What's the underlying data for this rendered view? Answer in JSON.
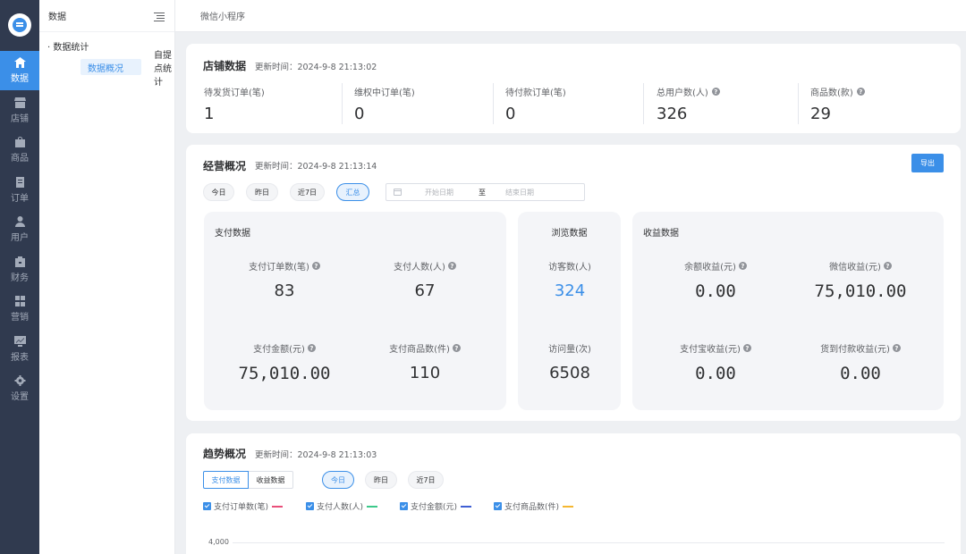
{
  "rail": {
    "items": [
      {
        "label": "数据",
        "icon": "home-icon"
      },
      {
        "label": "店铺",
        "icon": "store-icon"
      },
      {
        "label": "商品",
        "icon": "bag-icon"
      },
      {
        "label": "订单",
        "icon": "order-icon"
      },
      {
        "label": "用户",
        "icon": "user-icon"
      },
      {
        "label": "财务",
        "icon": "wallet-icon"
      },
      {
        "label": "营销",
        "icon": "grid-icon"
      },
      {
        "label": "报表",
        "icon": "chart-icon"
      },
      {
        "label": "设置",
        "icon": "gear-icon"
      }
    ],
    "active_color": "#3b8fe8"
  },
  "subnav": {
    "title": "数据",
    "group": "· 数据统计",
    "links": [
      "数据概况",
      "自提点统计"
    ]
  },
  "topbar": {
    "title": "微信小程序"
  },
  "store": {
    "title": "店铺数据",
    "time": "更新时间：2024-9-8 21:13:02",
    "stats": [
      {
        "label": "待发货订单(笔)",
        "value": "1",
        "help": false
      },
      {
        "label": "维权中订单(笔)",
        "value": "0",
        "help": false
      },
      {
        "label": "待付款订单(笔)",
        "value": "0",
        "help": false
      },
      {
        "label": "总用户数(人)",
        "value": "326",
        "help": true
      },
      {
        "label": "商品数(款)",
        "value": "29",
        "help": true
      }
    ]
  },
  "overview": {
    "title": "经营概况",
    "time": "更新时间：2024-9-8 21:13:14",
    "export": "导出",
    "filters": [
      "今日",
      "昨日",
      "近7日",
      "汇总"
    ],
    "active_filter": "汇总",
    "date_start": "开始日期",
    "date_sep": "至",
    "date_end": "结束日期",
    "pay": {
      "title": "支付数据",
      "metrics": [
        {
          "label": "支付订单数(笔)",
          "value": "83"
        },
        {
          "label": "支付人数(人)",
          "value": "67"
        },
        {
          "label": "支付金额(元)",
          "value": "75,010.00"
        },
        {
          "label": "支付商品数(件)",
          "value": "110"
        }
      ]
    },
    "browse": {
      "title": "浏览数据",
      "metrics": [
        {
          "label": "访客数(人)",
          "value": "324"
        },
        {
          "label": "访问量(次)",
          "value": "6508"
        }
      ]
    },
    "income": {
      "title": "收益数据",
      "metrics": [
        {
          "label": "余额收益(元)",
          "value": "0.00"
        },
        {
          "label": "微信收益(元)",
          "value": "75,010.00"
        },
        {
          "label": "支付宝收益(元)",
          "value": "0.00"
        },
        {
          "label": "货到付款收益(元)",
          "value": "0.00"
        }
      ]
    }
  },
  "trend": {
    "title": "趋势概况",
    "time": "更新时间：2024-9-8 21:13:03",
    "tabs": [
      "支付数据",
      "收益数据"
    ],
    "filters": [
      "今日",
      "昨日",
      "近7日"
    ],
    "active_filter": "今日",
    "legend": [
      {
        "label": "支付订单数(笔)",
        "color": "#e94f7a"
      },
      {
        "label": "支付人数(人)",
        "color": "#3cc98a"
      },
      {
        "label": "支付金额(元)",
        "color": "#3f5fd4"
      },
      {
        "label": "支付商品数(件)",
        "color": "#f5b731"
      }
    ],
    "y_tick": "4,000"
  }
}
